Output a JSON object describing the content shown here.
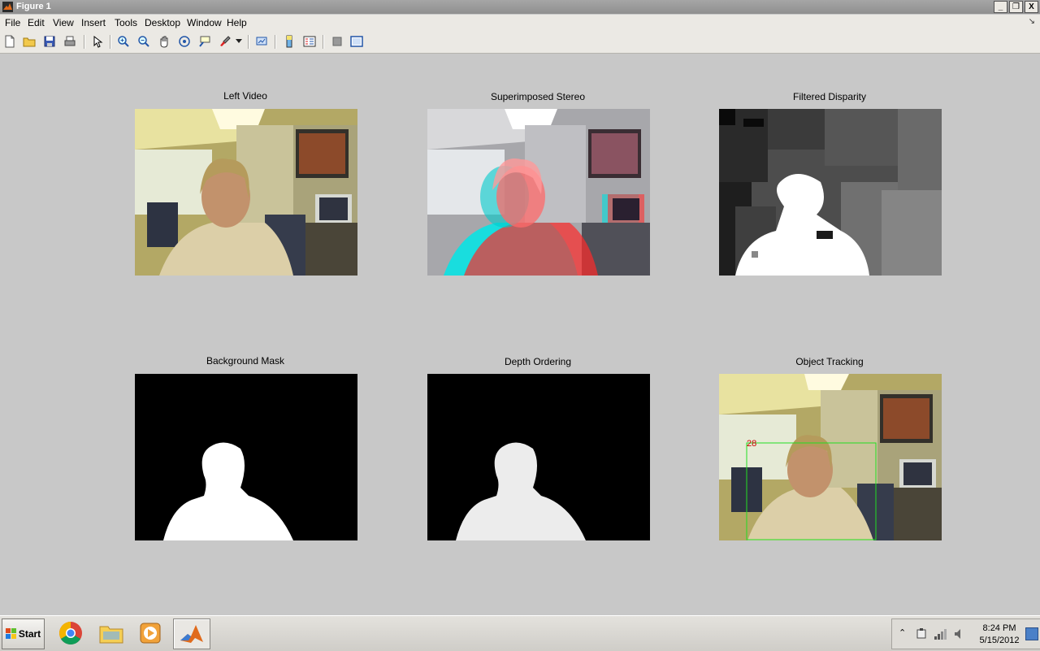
{
  "window": {
    "title": "Figure 1",
    "buttons": {
      "minimize": "_",
      "maximize": "❐",
      "close": "X"
    }
  },
  "menu": [
    "File",
    "Edit",
    "View",
    "Insert",
    "Tools",
    "Desktop",
    "Window",
    "Help"
  ],
  "toolbar": {
    "items": [
      "new-figure-icon",
      "open-file-icon",
      "save-figure-icon",
      "print-figure-icon",
      "edit-plot-icon",
      "zoom-in-icon",
      "zoom-out-icon",
      "pan-icon",
      "rotate-3d-icon",
      "data-cursor-icon",
      "brush-icon",
      "brush-dropdown-icon",
      "link-plot-icon",
      "insert-colorbar-icon",
      "insert-legend-icon",
      "hide-plot-tools-icon",
      "show-plot-tools-icon"
    ]
  },
  "panels": [
    {
      "title": "Left Video"
    },
    {
      "title": "Superimposed Stereo"
    },
    {
      "title": "Filtered Disparity"
    },
    {
      "title": "Background Mask"
    },
    {
      "title": "Depth Ordering"
    },
    {
      "title": "Object Tracking",
      "tracking_label": "28"
    }
  ],
  "taskbar": {
    "start_label": "Start",
    "apps": [
      "chrome-icon",
      "windows-explorer-icon",
      "media-player-icon",
      "matlab-icon"
    ],
    "tray_icons": [
      "show-hidden-icons-icon",
      "network-device-icon",
      "signal-icon",
      "volume-icon"
    ],
    "time": "8:24 PM",
    "date": "5/15/2012"
  },
  "colors": {
    "tracking_box": "#22dd22",
    "tracking_label": "#cc0000"
  }
}
